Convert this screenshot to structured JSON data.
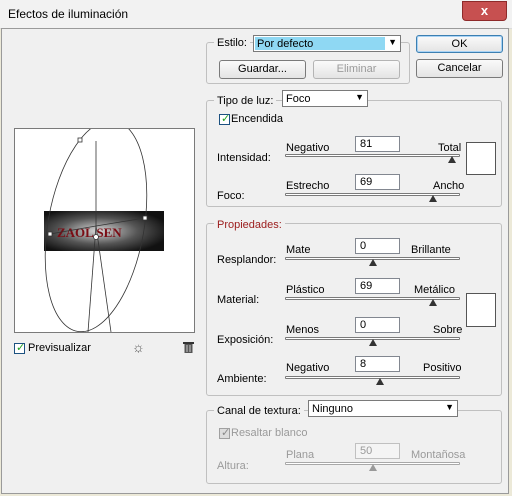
{
  "window": {
    "title": "Efectos de iluminación",
    "close_glyph": "x"
  },
  "style": {
    "label": "Estilo:",
    "value": "Por defecto",
    "save_label": "Guardar...",
    "delete_label": "Eliminar"
  },
  "buttons": {
    "ok": "OK",
    "cancel": "Cancelar"
  },
  "light": {
    "group_label": "Tipo de luz:",
    "type_value": "Foco",
    "on_label": "Encendida",
    "on_checked": true,
    "intensity": {
      "label": "Intensidad:",
      "min": "Negativo",
      "max": "Total",
      "value": "81",
      "fraction": 0.955
    },
    "focus": {
      "label": "Foco:",
      "min": "Estrecho",
      "max": "Ancho",
      "value": "69",
      "fraction": 0.845
    }
  },
  "properties": {
    "group_label": "Propiedades:",
    "gloss": {
      "label": "Resplandor:",
      "min": "Mate",
      "max": "Brillante",
      "value": "0",
      "fraction": 0.5
    },
    "material": {
      "label": "Material:",
      "min": "Plástico",
      "max": "Metálico",
      "value": "69",
      "fraction": 0.845
    },
    "exposure": {
      "label": "Exposición:",
      "min": "Menos",
      "max": "Sobre",
      "value": "0",
      "fraction": 0.5
    },
    "ambience": {
      "label": "Ambiente:",
      "min": "Negativo",
      "max": "Positivo",
      "value": "8",
      "fraction": 0.54
    }
  },
  "texture": {
    "group_label": "Canal de textura:",
    "channel_value": "Ninguno",
    "white_high_label": "Resaltar blanco",
    "white_high_checked": true,
    "height": {
      "label": "Altura:",
      "min": "Plana",
      "max": "Montañosa",
      "value": "50",
      "fraction": 0.5
    }
  },
  "preview": {
    "label": "Previsualizar",
    "checked": true,
    "preview_text": "ZAOL SEN"
  },
  "colors": {
    "accent_select": "#8fd8f3",
    "properties_label": "#9b1b1b"
  }
}
